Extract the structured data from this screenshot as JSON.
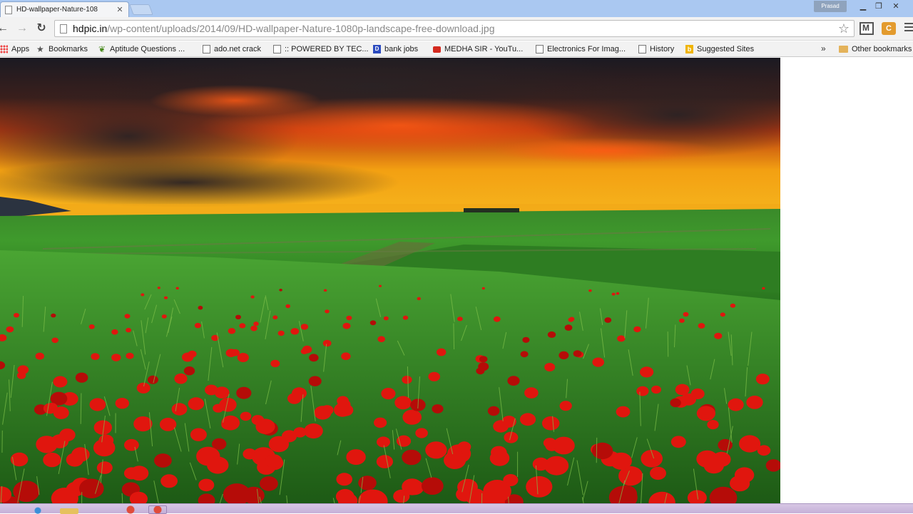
{
  "browser": {
    "tab": {
      "title": "HD-wallpaper-Nature-108"
    },
    "profile_name": "Prasad",
    "address": {
      "host": "hdpic.in",
      "path": "/wp-content/uploads/2014/09/HD-wallpaper-Nature-1080p-landscape-free-download.jpg"
    },
    "bookmarks": [
      {
        "label": "Apps",
        "icon": "apps-grid-icon"
      },
      {
        "label": "Bookmarks",
        "icon": "star-icon"
      },
      {
        "label": "Aptitude Questions ...",
        "icon": "leaf-icon"
      },
      {
        "label": "ado.net crack",
        "icon": "page-icon"
      },
      {
        "label": ":: POWERED BY TEC...",
        "icon": "page-icon"
      },
      {
        "label": "bank jobs",
        "icon": "d-icon"
      },
      {
        "label": "MEDHA SIR - YouTu...",
        "icon": "youtube-icon"
      },
      {
        "label": "Electronics For Imag...",
        "icon": "page-icon"
      },
      {
        "label": "History",
        "icon": "page-icon"
      },
      {
        "label": "Suggested Sites",
        "icon": "bing-icon"
      }
    ],
    "overflow_chevron": "»",
    "other_bookmarks": "Other bookmarks"
  },
  "content": {
    "image": "landscape photo: red poppy field under a sunset sky with dark clouds"
  },
  "colors": {
    "tabstrip": "#aac8f1",
    "toolbar": "#f2f2f2",
    "taskbar": "#c5b0d8",
    "sky_orange": "#f3a012",
    "field_green": "#3f9a2c",
    "poppy_red": "#e0160e"
  }
}
